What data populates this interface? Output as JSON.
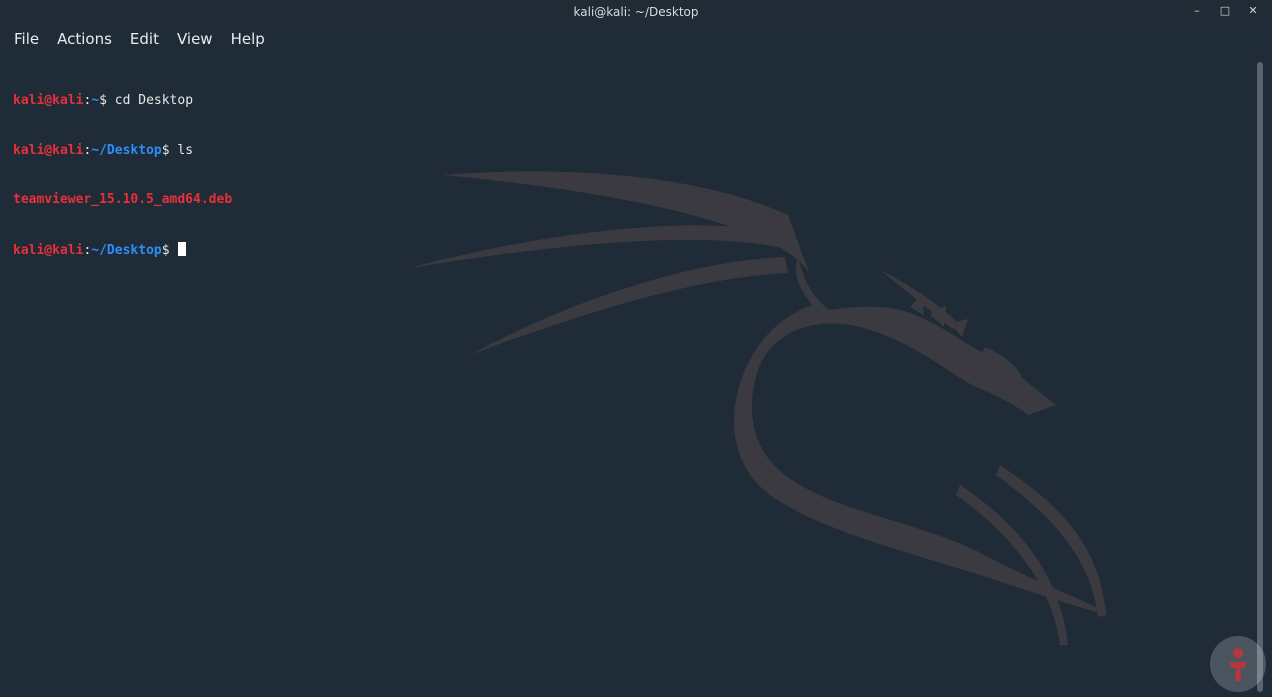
{
  "window": {
    "title": "kali@kali: ~/Desktop",
    "controls": {
      "minimize": "–",
      "maximize": "□",
      "close": "✕"
    }
  },
  "menu": {
    "file": "File",
    "actions": "Actions",
    "edit": "Edit",
    "view": "View",
    "help": "Help"
  },
  "terminal": {
    "lines": [
      {
        "user": "kali@kali",
        "sep": ":",
        "path": "~",
        "prompt": "$ ",
        "command": "cd Desktop"
      },
      {
        "user": "kali@kali",
        "sep": ":",
        "path": "~/Desktop",
        "prompt": "$ ",
        "command": "ls"
      },
      {
        "output": "teamviewer_15.10.5_amd64.deb"
      },
      {
        "user": "kali@kali",
        "sep": ":",
        "path": "~/Desktop",
        "prompt": "$ ",
        "command": ""
      }
    ]
  },
  "colors": {
    "background": "#1f2b37",
    "prompt_user": "#e8303a",
    "prompt_path": "#2c8ef7",
    "dragon": "#3a3a40"
  }
}
